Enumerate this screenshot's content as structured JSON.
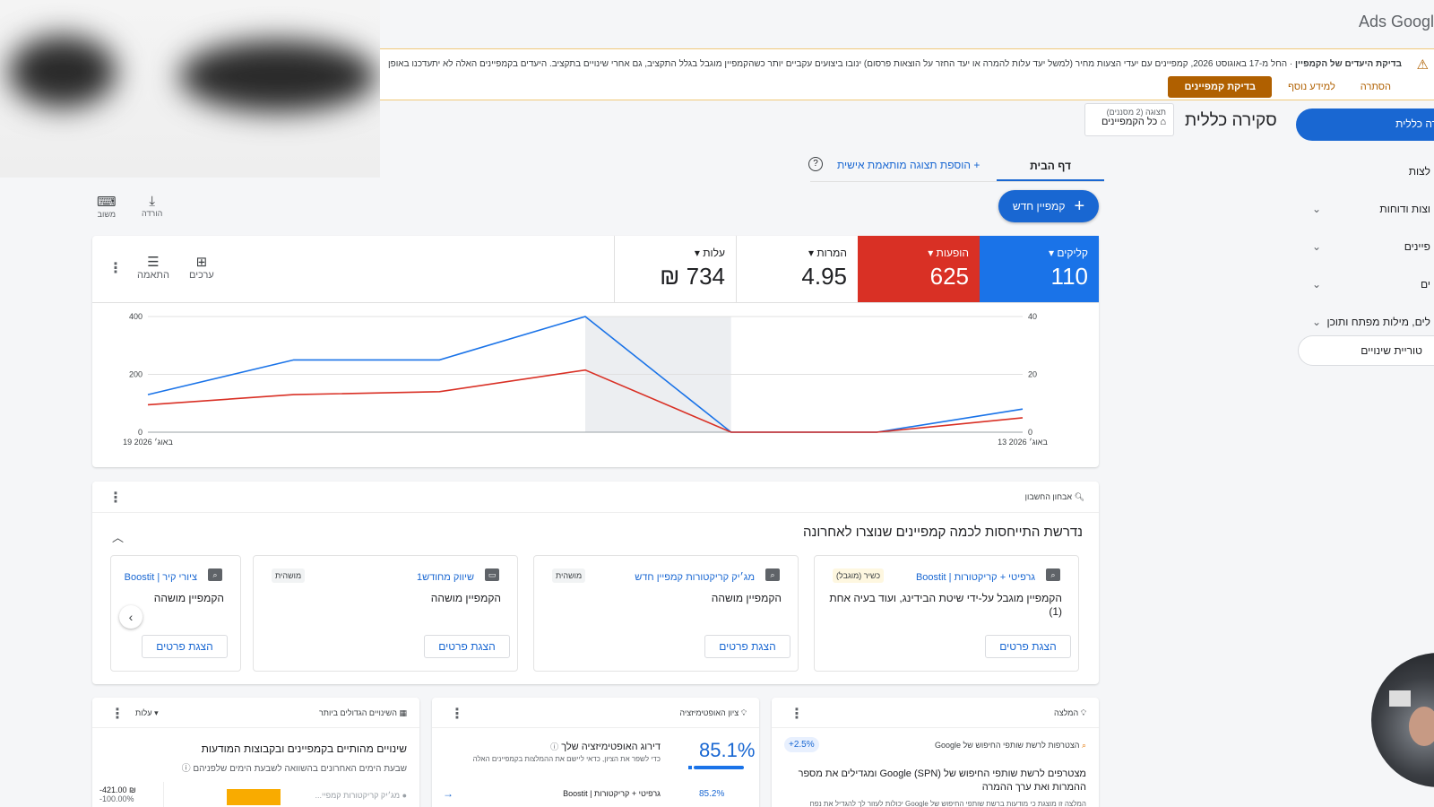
{
  "brand": "Ads Googl",
  "alert": {
    "bold": "בדיקת היעדים של הקמפיין",
    "text": " · החל מ-17 באוגוסט 2026, קמפיינים עם יעדי הצעות מחיר (למשל יעד עלות להמרה או יעד החזר על הוצאות פרסום) ינובו ביצועים עקביים יותר כשהקמפיין מוגבל בגלל התקציב, גם אחרי שינויים בתקציב. היעדים בקמפיינים האלה לא יתעדכנו באופן",
    "review_label": "בדיקת קמפיינים",
    "learn_more": "למידע נוסף",
    "dismiss": "הסתרה"
  },
  "nav": {
    "overview": "רה כללית",
    "items": [
      {
        "label": "לצות"
      },
      {
        "label": "וצות ודוחות"
      },
      {
        "label": "פיינים"
      },
      {
        "label": "ים"
      },
      {
        "label": "לים, מילות מפתח ותוכן"
      }
    ],
    "history": "טוריית שינויים"
  },
  "page": {
    "title": "סקירה כללית",
    "scope_label": "תצוגה (2 מסננים)",
    "scope_value": "כל הקמפיינים"
  },
  "tabs": {
    "home": "דף הבית",
    "add": "+ הוספת תצוגה מותאמת אישית",
    "help": "?"
  },
  "new_campaign": "קמפיין חדש",
  "tools": {
    "download": "הורדה",
    "feedback": "משוב",
    "values": "ערכים",
    "adjust": "התאמה"
  },
  "metrics": [
    {
      "label": "קליקים ▾",
      "value": "110",
      "color": "#1a73e8"
    },
    {
      "label": "הופעות ▾",
      "value": "625",
      "color": "#d93025"
    },
    {
      "label": "המרות ▾",
      "value": "4.95"
    },
    {
      "label": "עלות ▾",
      "value": "734 ₪"
    }
  ],
  "chart_data": {
    "type": "line",
    "x": [
      "13 באוג׳ 2026",
      "14",
      "15",
      "16",
      "17",
      "18",
      "19 באוג׳ 2026"
    ],
    "x_labels_shown": [
      "13 באוג׳ 2026",
      "19 באוג׳ 2026"
    ],
    "series": [
      {
        "name": "קליקים",
        "axis": "right",
        "color": "#1a73e8",
        "values": [
          8,
          0,
          0,
          40,
          25,
          25,
          13
        ]
      },
      {
        "name": "הופעות",
        "axis": "left",
        "color": "#d93025",
        "values": [
          50,
          0,
          0,
          215,
          140,
          130,
          95
        ]
      }
    ],
    "y_left": {
      "ticks": [
        "400",
        "200",
        "0"
      ],
      "range": [
        0,
        400
      ]
    },
    "y_right": {
      "ticks": [
        "40",
        "20",
        "0"
      ],
      "range": [
        0,
        40
      ]
    },
    "highlight_index": 3,
    "grid": true
  },
  "recs": {
    "header": "אבחון החשבון",
    "title": "נדרשת התייחסות לכמה קמפיינים שנוצרו לאחרונה",
    "cards": [
      {
        "name": "גרפיטי + קריקטורות | Boostit",
        "tag": "כשיר (מוגבל)",
        "status": "הקמפיין מוגבל על-ידי שיטת הבידינג, ועוד בעיה אחת (1)",
        "button": "הצגת פרטים"
      },
      {
        "name": "מג׳יק קריקטורות קמפיין חדש",
        "tag": "מושהית",
        "status": "הקמפיין מושהה",
        "button": "הצגת פרטים"
      },
      {
        "name": "שיווק מחודש1",
        "tag": "מושהית",
        "status": "הקמפיין מושהה",
        "button": "הצגת פרטים"
      },
      {
        "name": "ציורי קיר | Boostit",
        "tag": "",
        "status": "הקמפיין מושהה",
        "button": "הצגת פרטים"
      }
    ]
  },
  "bottom": {
    "rec": {
      "header": "המלצה",
      "sub": "הצטרפות לרשת שותפי החיפוש של Google",
      "badge": "+2.5%",
      "title": "מצטרפים לרשת שותפי החיפוש של Google (SPN) ומגדילים את מספר ההמרות ואת ערך ההמרה",
      "footer": "המלצה זו מוצגת כי מודעות ברשת שותפי החיפוש של Google יכולות לעזור לך להגדיל את נפח"
    },
    "opt": {
      "header": "ציון האופטימיזציה",
      "score": "85.1%",
      "title": "דירוג האופטימיזציה שלך",
      "desc": "כדי לשפר את הציון, כדאי ליישם את ההמלצות בקמפיינים האלה",
      "row_name": "גרפיטי + קריקטורות | Boostit",
      "row_score": "85.2%"
    },
    "changes": {
      "header": "השינויים הגדולים ביותר",
      "metric": "עלות ▾",
      "title": "שינויים מהותיים בקמפיינים ובקבוצות המודעות",
      "sub": "שבעת הימים האחרונים בהשוואה לשבעת הימים שלפניהם",
      "row_name": "מג׳יק קריקטורות קמפיי...",
      "row_value": "-421.00 ₪",
      "row_pct": "-100.00%"
    }
  }
}
